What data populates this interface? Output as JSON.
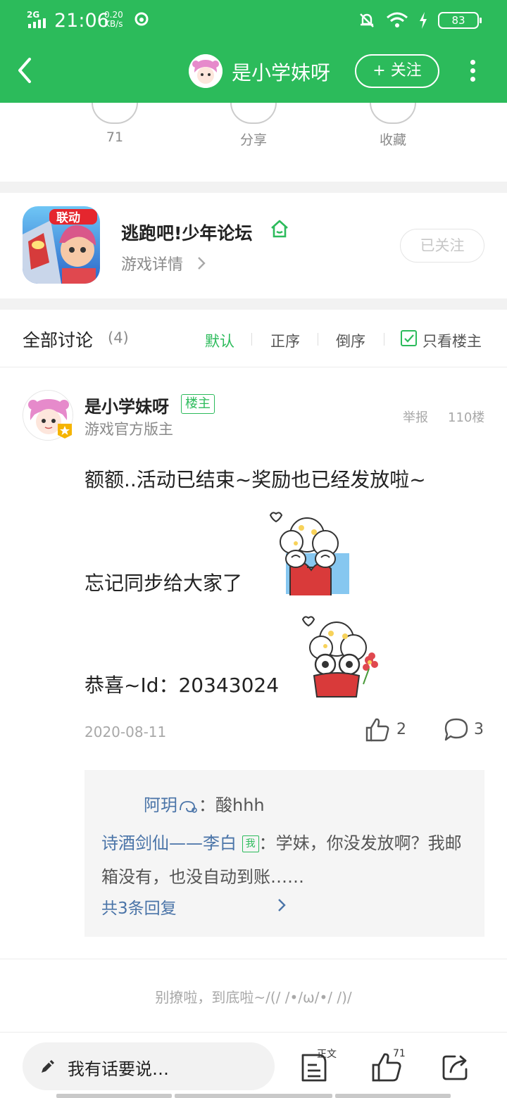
{
  "status_bar": {
    "network": "2G",
    "time": "21:06",
    "speed_value": "0.20",
    "speed_unit": "KB/s",
    "battery": "83"
  },
  "header": {
    "title": "是小学妹呀",
    "follow_label": "+ 关注",
    "back_icon": "back-arrow-icon",
    "more_icon": "more-vertical-icon"
  },
  "actions": [
    {
      "label": "71",
      "icon": "like-icon"
    },
    {
      "label": "分享",
      "icon": "share-icon"
    },
    {
      "label": "收藏",
      "icon": "star-icon"
    }
  ],
  "forum": {
    "name": "逃跑吧!少年论坛",
    "detail": "游戏详情",
    "followed_label": "已关注",
    "icon_badge": "联动"
  },
  "discussion": {
    "title": "全部讨论",
    "count": "(4)",
    "sort_default": "默认",
    "sort_asc": "正序",
    "sort_desc": "倒序",
    "only_host": "只看楼主"
  },
  "post": {
    "author": "是小学妹呀",
    "author_tag": "楼主",
    "role": "游戏官方版主",
    "report": "举报",
    "floor": "110楼",
    "line1": "额额..活动已结束~奖励也已经发放啦~",
    "line2": "忘记同步给大家了",
    "line3": "恭喜~Id：20343024",
    "date": "2020-08-11",
    "likes": "2",
    "comments": "3"
  },
  "replies": {
    "r1_user": "阿玥",
    "r1_text": "：酸hhh",
    "r2_user": "诗酒剑仙——李白",
    "r2_tag": "我",
    "r2_text": "：学妹，你没发放啊？我邮箱没有，也没自动到账……",
    "more": "共3条回复"
  },
  "footer": {
    "message": "别撩啦，到底啦~/(/ /•/ω/•/ /)/"
  },
  "bottom_bar": {
    "placeholder": "我有话要说…",
    "doc_label": "正文",
    "like_count": "71"
  },
  "colors": {
    "brand_green": "#2cbb5b",
    "link_blue": "#4a74a8",
    "muted": "#8a8a8a"
  }
}
